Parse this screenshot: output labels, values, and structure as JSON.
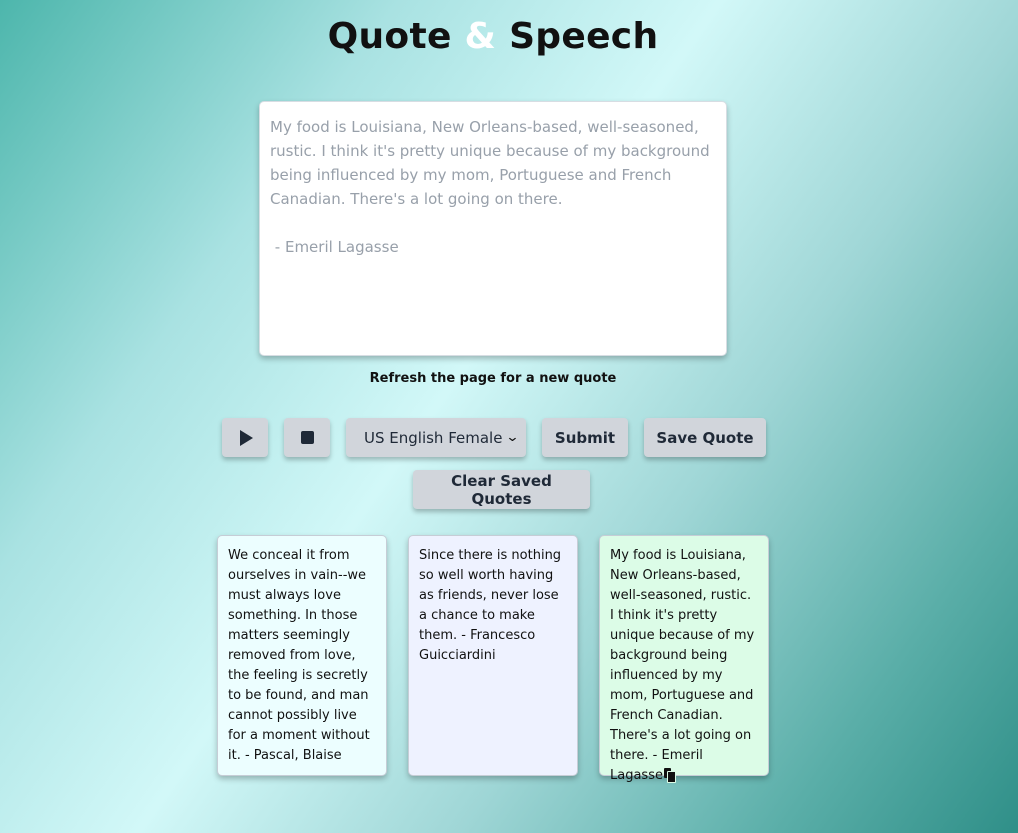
{
  "header": {
    "title_part1": "Quote",
    "title_amp": "&",
    "title_part2": "Speech"
  },
  "editor": {
    "text": "My food is Louisiana, New Orleans-based, well-seasoned, rustic. I think it's pretty unique because of my background being influenced by my mom, Portuguese and French Canadian. There's a lot going on there.\n\n - Emeril Lagasse"
  },
  "hint": "Refresh the page for a new quote",
  "controls": {
    "play_icon": "play-icon",
    "stop_icon": "stop-icon",
    "voice_selected": "US English Female",
    "submit_label": "Submit",
    "save_label": "Save Quote",
    "clear_label": "Clear Saved Quotes"
  },
  "saved_quotes": [
    {
      "text": "We conceal it from ourselves in vain--we must always love something. In those matters seemingly removed from love, the feeling is secretly to be found, and man cannot possibly live for a moment without it. - Pascal, Blaise",
      "color": "#ecfeff"
    },
    {
      "text": "Since there is nothing so well worth having as friends, never lose a chance to make them. - Francesco Guicciardini",
      "color": "#eef2ff"
    },
    {
      "text": "My food is Louisiana, New Orleans-based, well-seasoned, rustic. I think it's pretty unique because of my background being influenced by my mom, Portuguese and French Canadian. There's a lot going on there. - Emeril Lagasse",
      "color": "#dcfce7",
      "icon": "copy-icon"
    }
  ]
}
